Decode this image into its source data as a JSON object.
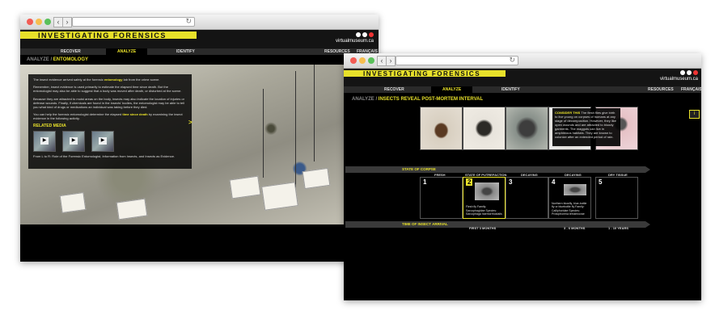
{
  "window1": {
    "brand": "INVESTIGATING FORENSICS",
    "site_logo_text": "virtualmuseum.ca",
    "nav": {
      "recover": "RECOVER",
      "analyze": "ANALYZE",
      "identify": "IDENTIFY",
      "resources": "RESOURCES",
      "lang": "FRANÇAIS"
    },
    "breadcrumb": {
      "prefix": "ANALYZE /",
      "current": "ENTOMOLOGY"
    },
    "info": {
      "p1_a": "The insect evidence arrived safely at the forensic ",
      "p1_hl": "entomology",
      "p1_b": " lab from the crime scene.",
      "p2": "Remember, insect evidence is used primarily to estimate the elapsed time since death. But the entomologist may also be able to suggest that a body was moved after death, or disturbed at the scene.",
      "p3": "Because they are attracted to moist areas on the body, insects may also indicate the location of injuries or defense wounds. Finally, if chemicals are found in the insects' bodies, the entomologist may be able to tell you what kind of drugs or medications an individual was taking before they died.",
      "p4_a": "You can help the forensic entomologist determine the elapsed ",
      "p4_hl": "time since death",
      "p4_b": " by examining the insect evidence in the following activity.",
      "related_title": "RELATED MEDIA",
      "credits": "From L to R: Role of the Forensic Entomologist, Information from Insects, and Insects as Evidence."
    },
    "next_arrow": ">"
  },
  "window2": {
    "brand": "INVESTIGATING FORENSICS",
    "site_logo_text": "virtualmuseum.ca",
    "nav": {
      "recover": "RECOVER",
      "analyze": "ANALYZE",
      "identify": "IDENTIFY",
      "resources": "RESOURCES",
      "lang": "FRANÇAIS"
    },
    "breadcrumb": {
      "prefix": "ANALYZE /",
      "current": "INSECTS REVEAL POST-MORTEM INTERVAL"
    },
    "consider": {
      "hl": "CONSIDER THIS",
      "text": " The flesh flies give birth to live young on corpses of humans at any stage of decomposition. However, they like open wounds and are attracted to bloody garments. The maggots can live in amphibious habitats. They are known to colonize after an extended period of rain."
    },
    "info_button": "i",
    "state_band": {
      "title": "STATE OF CORPSE",
      "segments": [
        "FRESH",
        "STATE OF PUTREFACTION",
        "DECAYING",
        "DECAYING",
        "DRY TISSUE"
      ]
    },
    "cells": [
      {
        "num": "1",
        "caption": ""
      },
      {
        "num": "2",
        "caption": "Flesh fly Family: Sarcophagidae Species: Sarcophaga haemorrhoidalis"
      },
      {
        "num": "3",
        "caption": ""
      },
      {
        "num": "4",
        "caption": "Northern blowfly, blue-bottle fly or bluebottle fly Family: Calliphoridae Species: Protophormia terraenovae"
      },
      {
        "num": "5",
        "caption": ""
      }
    ],
    "time_band": {
      "title": "TIME OF INSECT ARRIVAL",
      "segments": [
        "FIRST 3 MONTHS",
        "3 - 6 MONTHS",
        "1 - 10 YEARS"
      ]
    }
  }
}
